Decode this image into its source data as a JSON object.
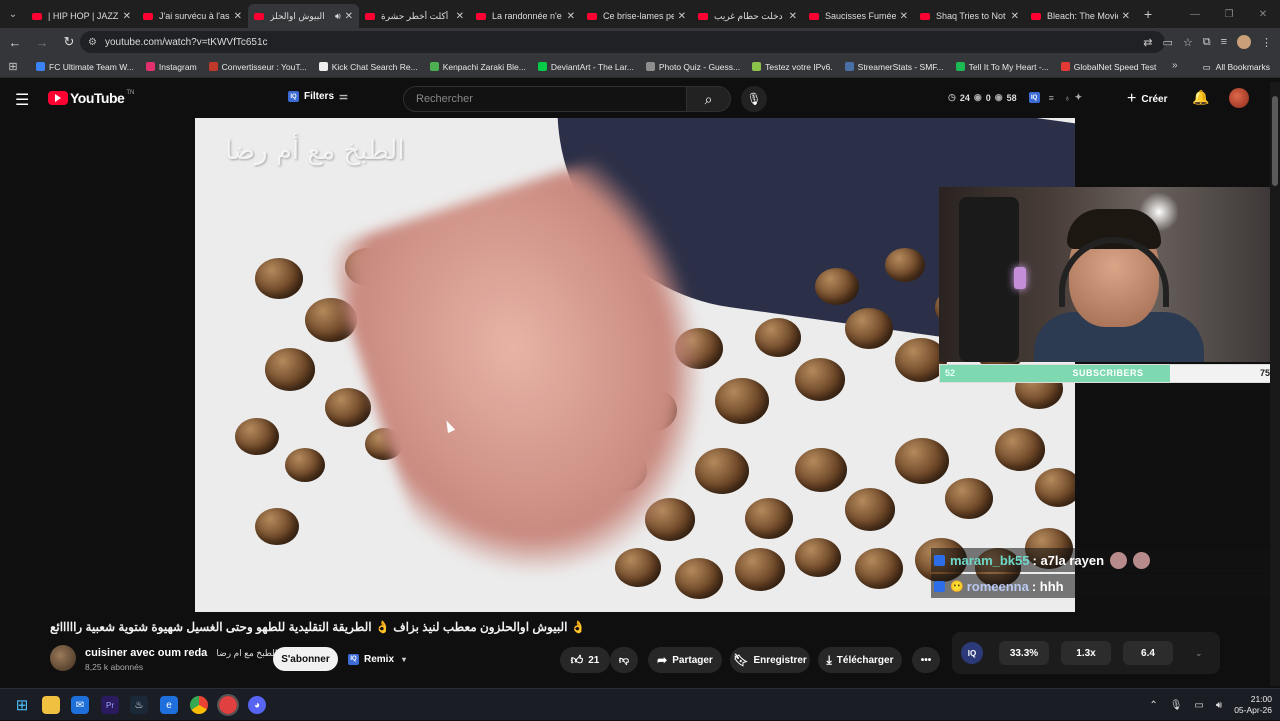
{
  "browser": {
    "tabs": [
      {
        "title": "| HIP HOP | JAZZ",
        "active": false
      },
      {
        "title": "J'ai survécu à l'as",
        "active": false
      },
      {
        "title": "البيوش اوالحلز",
        "active": true
      },
      {
        "title": "أكلت أخطر حشرة",
        "active": false
      },
      {
        "title": "La randonnée n'e",
        "active": false
      },
      {
        "title": "Ce brise-lames pe",
        "active": false
      },
      {
        "title": "دخلت حطام غريب",
        "active": false
      },
      {
        "title": "Saucisses Fumées",
        "active": false
      },
      {
        "title": "Shaq Tries to Not",
        "active": false
      },
      {
        "title": "Bleach: The Movie",
        "active": false
      }
    ],
    "url": "youtube.com/watch?v=tKWVfTc651c",
    "bookmarks": [
      {
        "label": "FC Ultimate Team W...",
        "color": "#3b82f6"
      },
      {
        "label": "Instagram",
        "color": "#e1306c"
      },
      {
        "label": "Convertisseur : YouT...",
        "color": "#c0392b"
      },
      {
        "label": "Kick Chat Search Re...",
        "color": "#eeeeee"
      },
      {
        "label": "Kenpachi Zaraki Ble...",
        "color": "#4caf50"
      },
      {
        "label": "DeviantArt - The Lar...",
        "color": "#05cc47"
      },
      {
        "label": "Photo Quiz - Guess...",
        "color": "#8e8e8e"
      },
      {
        "label": "Testez votre IPv6.",
        "color": "#8bc34a"
      },
      {
        "label": "StreamerStats - SMF...",
        "color": "#4a6fa5"
      },
      {
        "label": "Tell It To My Heart -...",
        "color": "#1db954"
      },
      {
        "label": "GlobalNet Speed Test",
        "color": "#e53935"
      }
    ],
    "all_bookmarks": "All Bookmarks"
  },
  "youtube": {
    "logo_text": "YouTube",
    "logo_tn": "TN",
    "filters_label": "Filters",
    "search_placeholder": "Rechercher",
    "stats": {
      "a": "24",
      "b": "0",
      "c": "58"
    },
    "create_label": "Créer"
  },
  "video": {
    "watermark": "الطبخ مع أم رضا",
    "title": "البيوش اوالحلزون معطب لنيذ بزاف 👌 الطريقة التقليدية للطهو وحتى الغسيل شهيوة شتوية شعبية رااااائع 👌",
    "channel_name": "cuisiner avec oum reda",
    "channel_name_ar": "الطبخ مع ام رضا",
    "subscribers": "8,25 k abonnés",
    "subscribe_label": "S'abonner",
    "remix_label": "Remix",
    "likes": "21",
    "share_label": "Partager",
    "save_label": "Enregistrer",
    "download_label": "Télécharger"
  },
  "stream_overlay": {
    "sub_bar": {
      "left": "52",
      "label": "SUBSCRIBERS",
      "right": "75",
      "progress": 0.69
    },
    "chat": [
      {
        "user": "maram_bk55",
        "message": ": a7la rayen"
      },
      {
        "user": "romeenna",
        "message": ": hhh"
      }
    ]
  },
  "iq_panel": {
    "v1": "33.3%",
    "v2": "1.3x",
    "v3": "6.4"
  },
  "taskbar": {
    "time": "21:00",
    "date": "05-Apr-26"
  }
}
